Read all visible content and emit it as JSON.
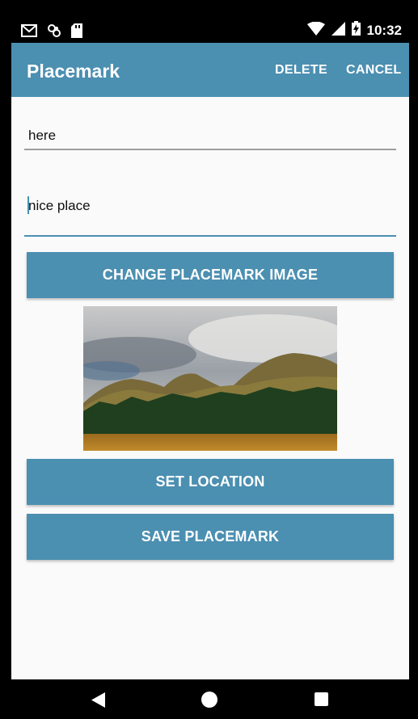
{
  "status_bar": {
    "time": "10:32",
    "left_icons": [
      "gmail-icon",
      "sync-icon",
      "sd-card-icon"
    ],
    "right_icons": [
      "wifi-icon",
      "cell-signal-icon",
      "battery-charging-icon"
    ]
  },
  "toolbar": {
    "title": "Placemark",
    "delete_label": "DELETE",
    "cancel_label": "CANCEL",
    "color": "#4b8fb1"
  },
  "form": {
    "title_value": "here",
    "description_value": "nice place"
  },
  "buttons": {
    "change_image": "CHANGE PLACEMARK IMAGE",
    "set_location": "SET LOCATION",
    "save": "SAVE PLACEMARK"
  },
  "image": {
    "subject": "mountain-landscape-photo"
  },
  "nav_bar": {
    "icons": [
      "back-icon",
      "home-icon",
      "recent-apps-icon"
    ]
  }
}
